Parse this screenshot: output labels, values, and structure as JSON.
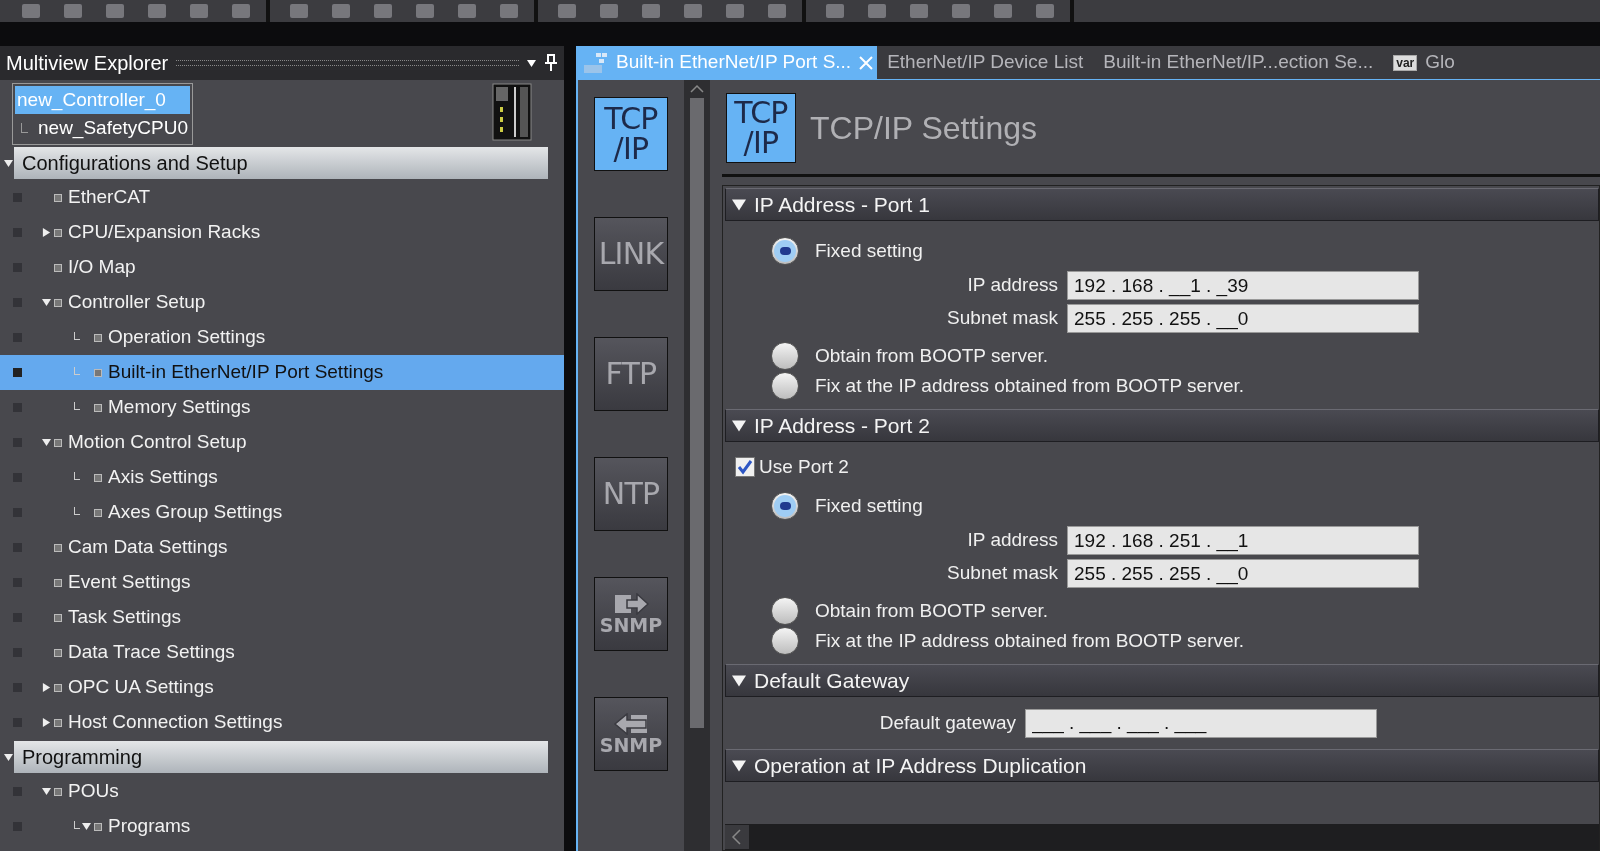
{
  "explorer": {
    "title": "Multiview Explorer",
    "devices": [
      {
        "name": "new_Controller_0",
        "selected": true
      },
      {
        "name": "new_SafetyCPU0",
        "selected": false
      }
    ],
    "sections": [
      {
        "title": "Configurations and Setup",
        "expanded": true,
        "items": [
          {
            "label": "EtherCAT",
            "selected": false
          },
          {
            "label": "CPU/Expansion Racks",
            "selected": false,
            "expanded": false
          },
          {
            "label": "I/O Map",
            "selected": false
          },
          {
            "label": "Controller Setup",
            "selected": false,
            "expanded": true,
            "children": [
              {
                "label": "Operation Settings",
                "selected": false
              },
              {
                "label": "Built-in EtherNet/IP Port Settings",
                "selected": true
              },
              {
                "label": "Memory Settings",
                "selected": false
              }
            ]
          },
          {
            "label": "Motion Control Setup",
            "selected": false,
            "expanded": true,
            "children": [
              {
                "label": "Axis Settings",
                "selected": false
              },
              {
                "label": "Axes Group Settings",
                "selected": false
              }
            ]
          },
          {
            "label": "Cam Data Settings",
            "selected": false
          },
          {
            "label": "Event Settings",
            "selected": false
          },
          {
            "label": "Task Settings",
            "selected": false
          },
          {
            "label": "Data Trace Settings",
            "selected": false
          },
          {
            "label": "OPC UA Settings",
            "selected": false,
            "expanded": false
          },
          {
            "label": "Host Connection Settings",
            "selected": false,
            "expanded": false
          }
        ]
      },
      {
        "title": "Programming",
        "expanded": true,
        "items": [
          {
            "label": "POUs",
            "selected": false,
            "expanded": true,
            "children": [
              {
                "label": "Programs",
                "selected": false,
                "expanded": true
              }
            ]
          }
        ]
      }
    ]
  },
  "tabs": [
    {
      "label": "Built-in EtherNet/IP Port S...",
      "selected": true,
      "closable": true,
      "kind": "eip"
    },
    {
      "label": "EtherNet/IP Device List",
      "selected": false,
      "closable": false,
      "kind": "plain"
    },
    {
      "label": "Built-in EtherNet/IP...ection Se...",
      "selected": false,
      "closable": false,
      "kind": "plain"
    },
    {
      "label": "Glo",
      "selected": false,
      "closable": false,
      "kind": "var",
      "badge": "var"
    }
  ],
  "settings_nav": [
    {
      "kind": "text",
      "lines": [
        "TCP",
        "/IP"
      ],
      "selected": true
    },
    {
      "kind": "text",
      "lines": [
        "LINK"
      ],
      "selected": false
    },
    {
      "kind": "text",
      "lines": [
        "FTP"
      ],
      "selected": false
    },
    {
      "kind": "text",
      "lines": [
        "NTP"
      ],
      "selected": false
    },
    {
      "kind": "snmp_out",
      "lines": [
        "SNMP"
      ],
      "selected": false
    },
    {
      "kind": "snmp_in",
      "lines": [
        "SNMP"
      ],
      "selected": false
    }
  ],
  "page": {
    "icon_lines": [
      "TCP",
      "/IP"
    ],
    "title": "TCP/IP Settings",
    "sections": [
      {
        "title": "IP Address - Port 1",
        "expanded": true,
        "options": [
          {
            "label": "Fixed setting",
            "selected": true,
            "fields": [
              {
                "label": "IP address",
                "value": "192 . 168 . __1 . _39"
              },
              {
                "label": "Subnet mask",
                "value": "255 . 255 . 255 . __0"
              }
            ]
          },
          {
            "label": "Obtain from BOOTP server.",
            "selected": false
          },
          {
            "label": "Fix at the IP address obtained from BOOTP server.",
            "selected": false
          }
        ]
      },
      {
        "title": "IP Address - Port 2",
        "expanded": true,
        "checkbox": {
          "label": "Use Port 2",
          "checked": true
        },
        "options": [
          {
            "label": "Fixed setting",
            "selected": true,
            "fields": [
              {
                "label": "IP address",
                "value": "192 . 168 . 251 . __1"
              },
              {
                "label": "Subnet mask",
                "value": "255 . 255 . 255 . __0"
              }
            ]
          },
          {
            "label": "Obtain from BOOTP server.",
            "selected": false
          },
          {
            "label": "Fix at the IP address obtained from BOOTP server.",
            "selected": false
          }
        ]
      },
      {
        "title": "Default Gateway",
        "expanded": true,
        "fields": [
          {
            "label": "Default gateway",
            "value": "___ . ___ . ___ . ___"
          }
        ]
      },
      {
        "title": "Operation at IP Address Duplication",
        "expanded": true
      }
    ]
  }
}
